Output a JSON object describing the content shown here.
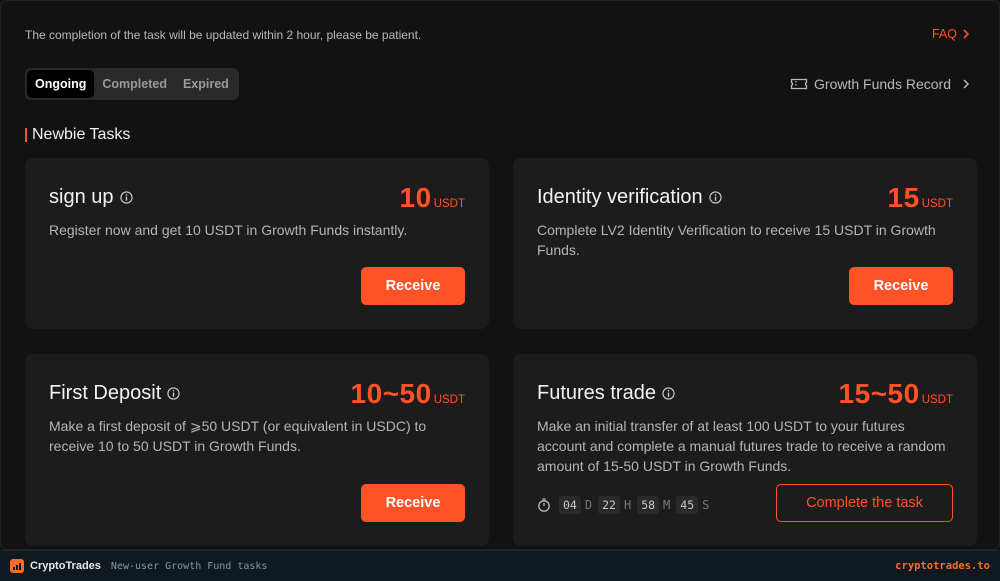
{
  "notice": "The completion of the task will be updated within 2 hour, please be patient.",
  "faq_label": "FAQ",
  "tabs": [
    {
      "label": "Ongoing",
      "active": true
    },
    {
      "label": "Completed",
      "active": false
    },
    {
      "label": "Expired",
      "active": false
    }
  ],
  "record_label": "Growth Funds Record",
  "section_title": "Newbie Tasks",
  "tasks": [
    {
      "title": "sign up",
      "amount": "10",
      "unit": "USDT",
      "description": "Register now and get 10 USDT in Growth Funds instantly.",
      "button": "Receive"
    },
    {
      "title": "Identity verification",
      "amount": "15",
      "unit": "USDT",
      "description": "Complete LV2 Identity Verification to receive 15 USDT in Growth Funds.",
      "button": "Receive"
    },
    {
      "title": "First Deposit",
      "amount": "10~50",
      "unit": "USDT",
      "description": "Make a first deposit of ⩾50 USDT (or equivalent in USDC) to receive 10 to 50 USDT in Growth Funds.",
      "button": "Receive"
    },
    {
      "title": "Futures trade",
      "amount": "15~50",
      "unit": "USDT",
      "description": "Make an initial transfer of at least 100 USDT to your futures account and complete a manual futures trade to receive a random amount of 15-50 USDT in Growth Funds.",
      "button": "Complete the task",
      "countdown": {
        "days": "04",
        "days_unit": "D",
        "hours": "22",
        "hours_unit": "H",
        "minutes": "58",
        "minutes_unit": "M",
        "seconds": "45",
        "seconds_unit": "S"
      }
    }
  ],
  "footer": {
    "brand": "CryptoTrades",
    "caption": "New-user Growth Fund tasks",
    "domain": "cryptotrades.to"
  },
  "colors": {
    "accent": "#ff5227",
    "background": "#121212",
    "card": "#1c1c1c"
  }
}
